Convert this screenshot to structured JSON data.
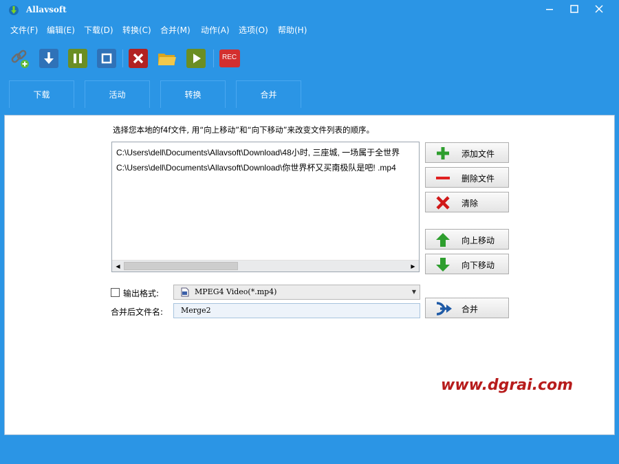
{
  "window": {
    "title": "Allavsoft"
  },
  "menu": [
    "文件(F)",
    "编辑(E)",
    "下载(D)",
    "转换(C)",
    "合并(M)",
    "动作(A)",
    "选项(O)",
    "帮助(H)"
  ],
  "toolbar": {
    "icons": [
      "add-link-icon",
      "download-icon",
      "pause-icon",
      "stop-icon",
      "delete-icon",
      "folder-icon",
      "play-icon",
      "record-icon"
    ],
    "rec_label": "REC"
  },
  "tabs": [
    "下载",
    "活动",
    "转换",
    "合并"
  ],
  "merge": {
    "instruction": "选择您本地的f4f文件, 用“向上移动”和“向下移动”来改变文件列表的顺序。",
    "files": [
      "C:\\Users\\dell\\Documents\\Allavsoft\\Download\\48小时, 三座城, 一场属于全世界",
      "C:\\Users\\dell\\Documents\\Allavsoft\\Download\\你世界杯又买南极队是吧! .mp4"
    ],
    "buttons": {
      "add": "添加文件",
      "delete": "删除文件",
      "clear": "清除",
      "up": "向上移动",
      "down": "向下移动",
      "merge": "合并"
    },
    "output_format_label": "输出格式:",
    "output_format_value": "MPEG4 Video(*.mp4)",
    "output_format_checked": false,
    "merged_name_label": "合并后文件名:",
    "merged_name_value": "Merge2"
  },
  "watermark": "www.dgrai.com",
  "colors": {
    "chrome": "#2b95e5",
    "accent_red": "#b71c1c"
  }
}
